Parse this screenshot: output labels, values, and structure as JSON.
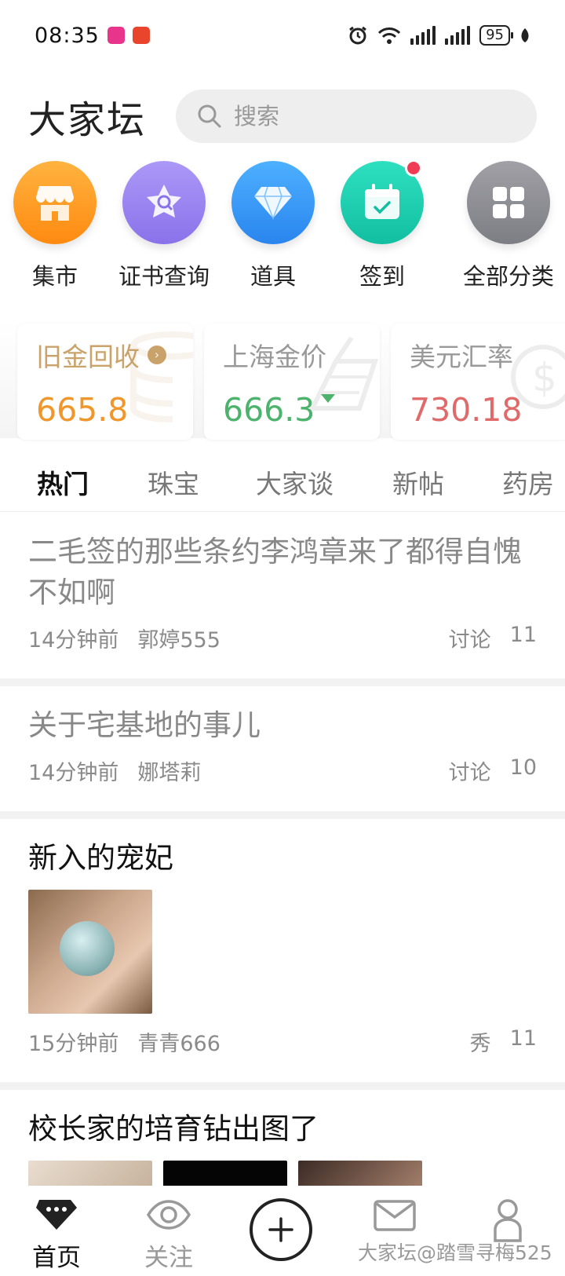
{
  "status_bar": {
    "time": "08:35",
    "battery": "95",
    "network": "6"
  },
  "header": {
    "logo": "大家坛",
    "search_placeholder": "搜索"
  },
  "categories": [
    {
      "label": "集市",
      "icon": "store-icon",
      "color": "#ff9a1f"
    },
    {
      "label": "证书查询",
      "icon": "certificate-search-icon",
      "color": "#9a84f0"
    },
    {
      "label": "道具",
      "icon": "diamond-icon",
      "color": "#3a9cf5"
    },
    {
      "label": "签到",
      "icon": "calendar-check-icon",
      "color": "#22cdb0",
      "has_notification_dot": true
    },
    {
      "label": "全部分类",
      "icon": "grid-icon",
      "color": "#8e8e93"
    }
  ],
  "prices": [
    {
      "title": "旧金回收",
      "value": "665.8",
      "value_color": "#f0962a",
      "title_color": "#c9a36a",
      "has_arrow": true
    },
    {
      "title": "上海金价",
      "value": "666.3",
      "value_color": "#4cb36c",
      "trend": "down"
    },
    {
      "title": "美元汇率",
      "value": "730.18",
      "value_color": "#e06a6a"
    }
  ],
  "tabs": [
    {
      "label": "热门",
      "active": true
    },
    {
      "label": "珠宝"
    },
    {
      "label": "大家谈"
    },
    {
      "label": "新帖"
    },
    {
      "label": "药房"
    }
  ],
  "posts": [
    {
      "title": "二毛签的那些条约李鸿章来了都得自愧不如啊",
      "time": "14分钟前",
      "author": "郭婷555",
      "tag": "讨论",
      "count": "11",
      "read": true
    },
    {
      "title": "关于宅基地的事儿",
      "time": "14分钟前",
      "author": "娜塔莉",
      "tag": "讨论",
      "count": "10",
      "read": true
    },
    {
      "title": "新入的宠妃",
      "time": "15分钟前",
      "author": "青青666",
      "tag": "秀",
      "count": "11",
      "read": false
    },
    {
      "title": "校长家的培育钻出图了",
      "read": false
    }
  ],
  "bottom_nav": [
    {
      "label": "首页",
      "icon": "home-chat-icon",
      "active": true
    },
    {
      "label": "关注",
      "icon": "eye-icon"
    },
    {
      "label": "",
      "icon": "plus-icon"
    },
    {
      "label": "",
      "icon": "mail-icon"
    },
    {
      "label": "",
      "icon": "profile-icon"
    }
  ],
  "watermark": "大家坛@踏雪寻梅525"
}
